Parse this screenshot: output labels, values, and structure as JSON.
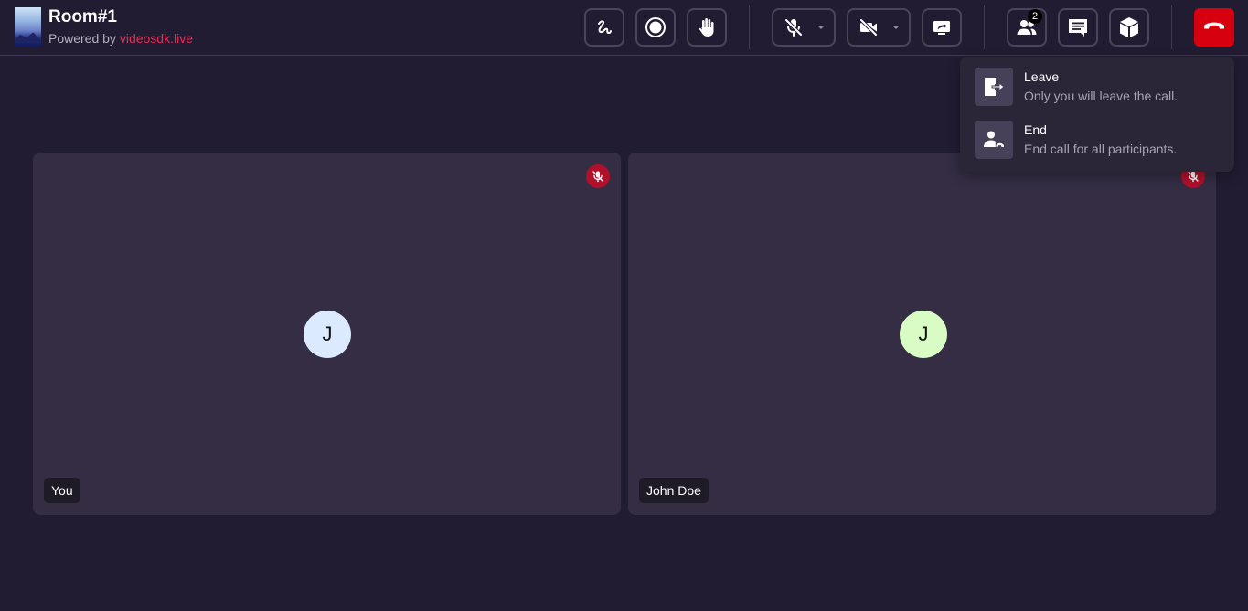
{
  "room": {
    "name": "Room#1",
    "powered_prefix": "Powered by ",
    "powered_link": "videosdk.live"
  },
  "toolbar": {
    "controls": [
      {
        "name": "whiteboard-button",
        "icon": "scribble-icon"
      },
      {
        "name": "record-button",
        "icon": "record-icon"
      },
      {
        "name": "raise-hand-button",
        "icon": "hand-icon"
      },
      {
        "name": "mic-button",
        "icon": "mic-off-icon",
        "state": "muted"
      },
      {
        "name": "webcam-button",
        "icon": "camera-off-icon",
        "state": "off"
      },
      {
        "name": "screen-share-button",
        "icon": "screen-share-icon"
      },
      {
        "name": "participants-button",
        "icon": "participants-icon"
      },
      {
        "name": "chat-button",
        "icon": "chat-icon"
      },
      {
        "name": "meeting-info-button",
        "icon": "cube-icon"
      },
      {
        "name": "end-call-button",
        "icon": "phone-hangup-icon"
      }
    ],
    "participants_count": "2"
  },
  "tiles": [
    {
      "avatar_letter": "J",
      "name": "You",
      "avatar_color": "#dbeaff",
      "mic": "off"
    },
    {
      "avatar_letter": "J",
      "name": "John Doe",
      "avatar_color": "#d9fcc5",
      "mic": "off"
    }
  ],
  "end_menu": {
    "items": [
      {
        "title": "Leave",
        "description": "Only you will leave the call.",
        "icon": "leave-icon"
      },
      {
        "title": "End",
        "description": "End call for all participants.",
        "icon": "end-for-all-icon"
      }
    ]
  },
  "colors": {
    "background": "#221c32",
    "tile": "#342d44",
    "accent": "#e52d56",
    "end_button": "#d7000f",
    "mic_off_badge": "#b0102a"
  }
}
